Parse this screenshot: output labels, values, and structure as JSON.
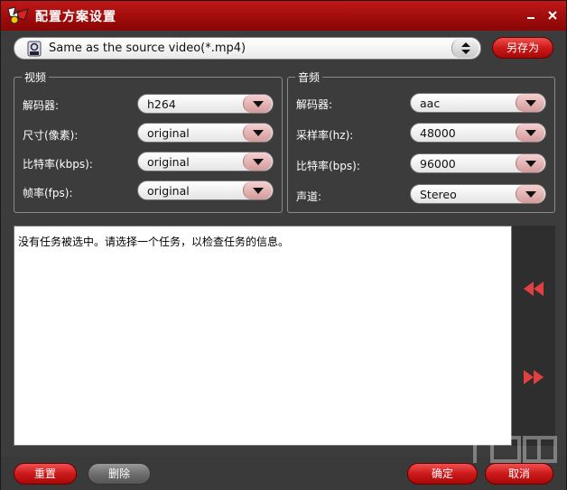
{
  "window": {
    "title": "配置方案设置"
  },
  "profile": {
    "selected": "Same as the source video(*.mp4)",
    "save_as_label": "另存为"
  },
  "video": {
    "group_title": "视频",
    "fields": [
      {
        "label": "解码器:",
        "value": "h264"
      },
      {
        "label": "尺寸(像素):",
        "value": "original"
      },
      {
        "label": "比特率(kbps):",
        "value": "original"
      },
      {
        "label": "帧率(fps):",
        "value": "original"
      }
    ]
  },
  "audio": {
    "group_title": "音频",
    "fields": [
      {
        "label": "解码器:",
        "value": "aac"
      },
      {
        "label": "采样率(hz):",
        "value": "48000"
      },
      {
        "label": "比特率(bps):",
        "value": "96000"
      },
      {
        "label": "声道:",
        "value": "Stereo"
      }
    ]
  },
  "info": {
    "message": "没有任务被选中。请选择一个任务，以检查任务的信息。"
  },
  "buttons": {
    "reset": "重置",
    "delete": "删除",
    "ok": "确定",
    "cancel": "取消"
  },
  "colors": {
    "title_bar": "#b01010",
    "accent_red": "#cc1a1a",
    "nav_arrow": "#e04040",
    "panel_bg": "#3c3c3c"
  }
}
